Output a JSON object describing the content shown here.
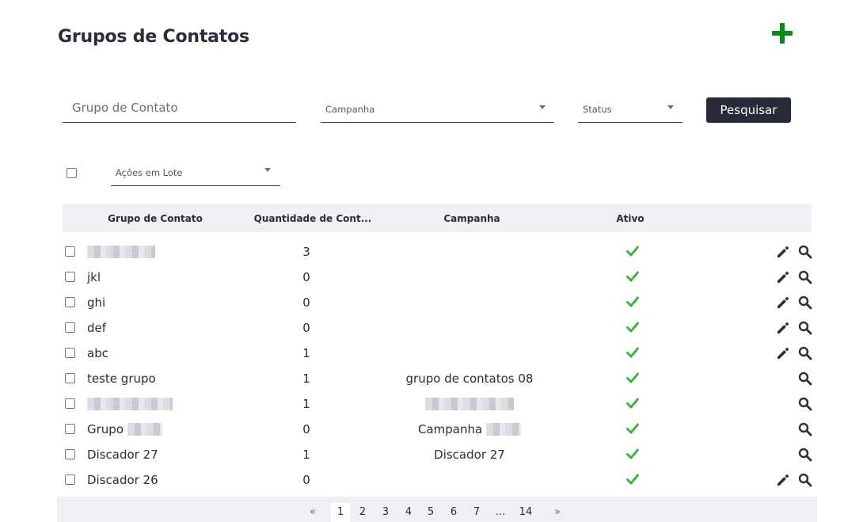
{
  "page": {
    "title": "Grupos de Contatos"
  },
  "filters": {
    "group_placeholder": "Grupo de Contato",
    "campaign_label": "Campanha",
    "status_label": "Status",
    "search_label": "Pesquisar"
  },
  "batch": {
    "label": "Ações em Lote"
  },
  "table": {
    "headers": {
      "name": "Grupo de Contato",
      "quantity": "Quantidade de Cont...",
      "campaign": "Campanha",
      "active": "Ativo"
    },
    "rows": [
      {
        "name": "",
        "quantity": "3",
        "campaign": "",
        "editable": true
      },
      {
        "name": "jkl",
        "quantity": "0",
        "campaign": "",
        "editable": true
      },
      {
        "name": "ghi",
        "quantity": "0",
        "campaign": "",
        "editable": true
      },
      {
        "name": "def",
        "quantity": "0",
        "campaign": "",
        "editable": true
      },
      {
        "name": "abc",
        "quantity": "1",
        "campaign": "",
        "editable": true
      },
      {
        "name": "teste grupo",
        "quantity": "1",
        "campaign": "grupo de contatos 08",
        "editable": false
      },
      {
        "name": "",
        "quantity": "1",
        "campaign": "",
        "editable": false
      },
      {
        "name": "Grupo",
        "quantity": "0",
        "campaign": "Campanha",
        "editable": false
      },
      {
        "name": "Discador 27",
        "quantity": "1",
        "campaign": "Discador 27",
        "editable": false
      },
      {
        "name": "Discador 26",
        "quantity": "0",
        "campaign": "",
        "editable": true
      }
    ]
  },
  "pagination": {
    "prev": "«",
    "next": "»",
    "pages": [
      "1",
      "2",
      "3",
      "4",
      "5",
      "6",
      "7",
      "...",
      "14"
    ],
    "active": "1"
  },
  "colors": {
    "accent_green": "#0a8a1a",
    "check_green": "#3cb44b",
    "button_dark": "#272a38",
    "header_bg": "#eff0f3"
  },
  "icons": {
    "add": "plus-icon",
    "active": "check-icon",
    "edit": "pencil-icon",
    "view": "search-icon"
  }
}
